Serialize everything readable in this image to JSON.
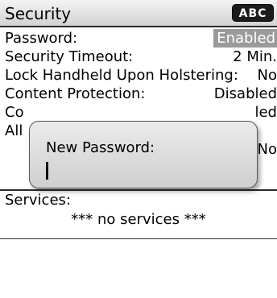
{
  "header": {
    "title": "Security",
    "input_mode": "ABC"
  },
  "options": [
    {
      "label": "Password:",
      "value": "Enabled",
      "selected": true
    },
    {
      "label": "Security Timeout:",
      "value": "2 Min."
    },
    {
      "label": "Lock Handheld Upon Holstering:",
      "value": "No"
    },
    {
      "label": "Content Protection:",
      "value": "Disabled"
    },
    {
      "label": "Co",
      "value": "led"
    },
    {
      "label": "All",
      "value": ""
    },
    {
      "label": "",
      "value": "No"
    }
  ],
  "services": {
    "label": "Services:",
    "empty_text": "*** no services ***"
  },
  "dialog": {
    "prompt": "New Password:",
    "value": ""
  }
}
